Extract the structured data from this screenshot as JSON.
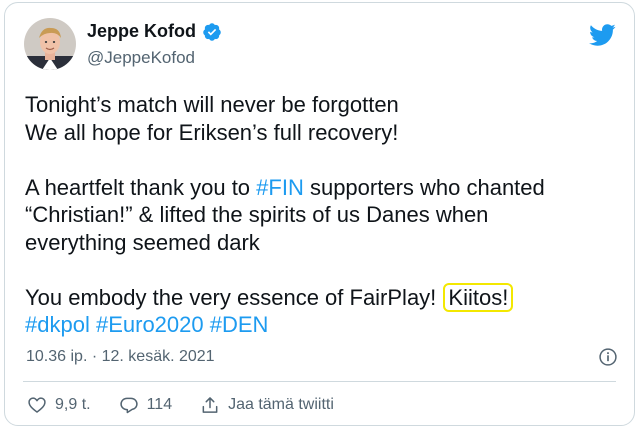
{
  "author": {
    "name": "Jeppe Kofod",
    "handle": "@JeppeKofod",
    "verified": true
  },
  "tweet": {
    "line1": "Tonight’s match will never be forgotten",
    "line2": "We all hope for Eriksen’s full recovery!",
    "line3_pre": "A heartfelt thank you to ",
    "line3_tag": "#FIN",
    "line3_post": " supporters who chanted",
    "line4": "“Christian!” & lifted the spirits of us Danes when",
    "line5": "everything seemed dark",
    "line6_pre": "You embody the very essence of FairPlay! ",
    "line6_highlight": "Kiitos!",
    "hashtags": [
      "#dkpol",
      "#Euro2020",
      "#DEN"
    ]
  },
  "meta": {
    "timestamp": "10.36 ip. · 12. kesäk. 2021"
  },
  "actions": {
    "likes": "9,9 t.",
    "replies": "114",
    "share": "Jaa tämä twiitti"
  },
  "colors": {
    "link": "#1d9bf0",
    "highlight": "#f3e800",
    "muted": "#536471",
    "border": "#cfd9de"
  },
  "icons": [
    "twitter-bird-icon",
    "verified-badge-icon",
    "info-icon",
    "heart-icon",
    "reply-icon",
    "share-icon"
  ]
}
